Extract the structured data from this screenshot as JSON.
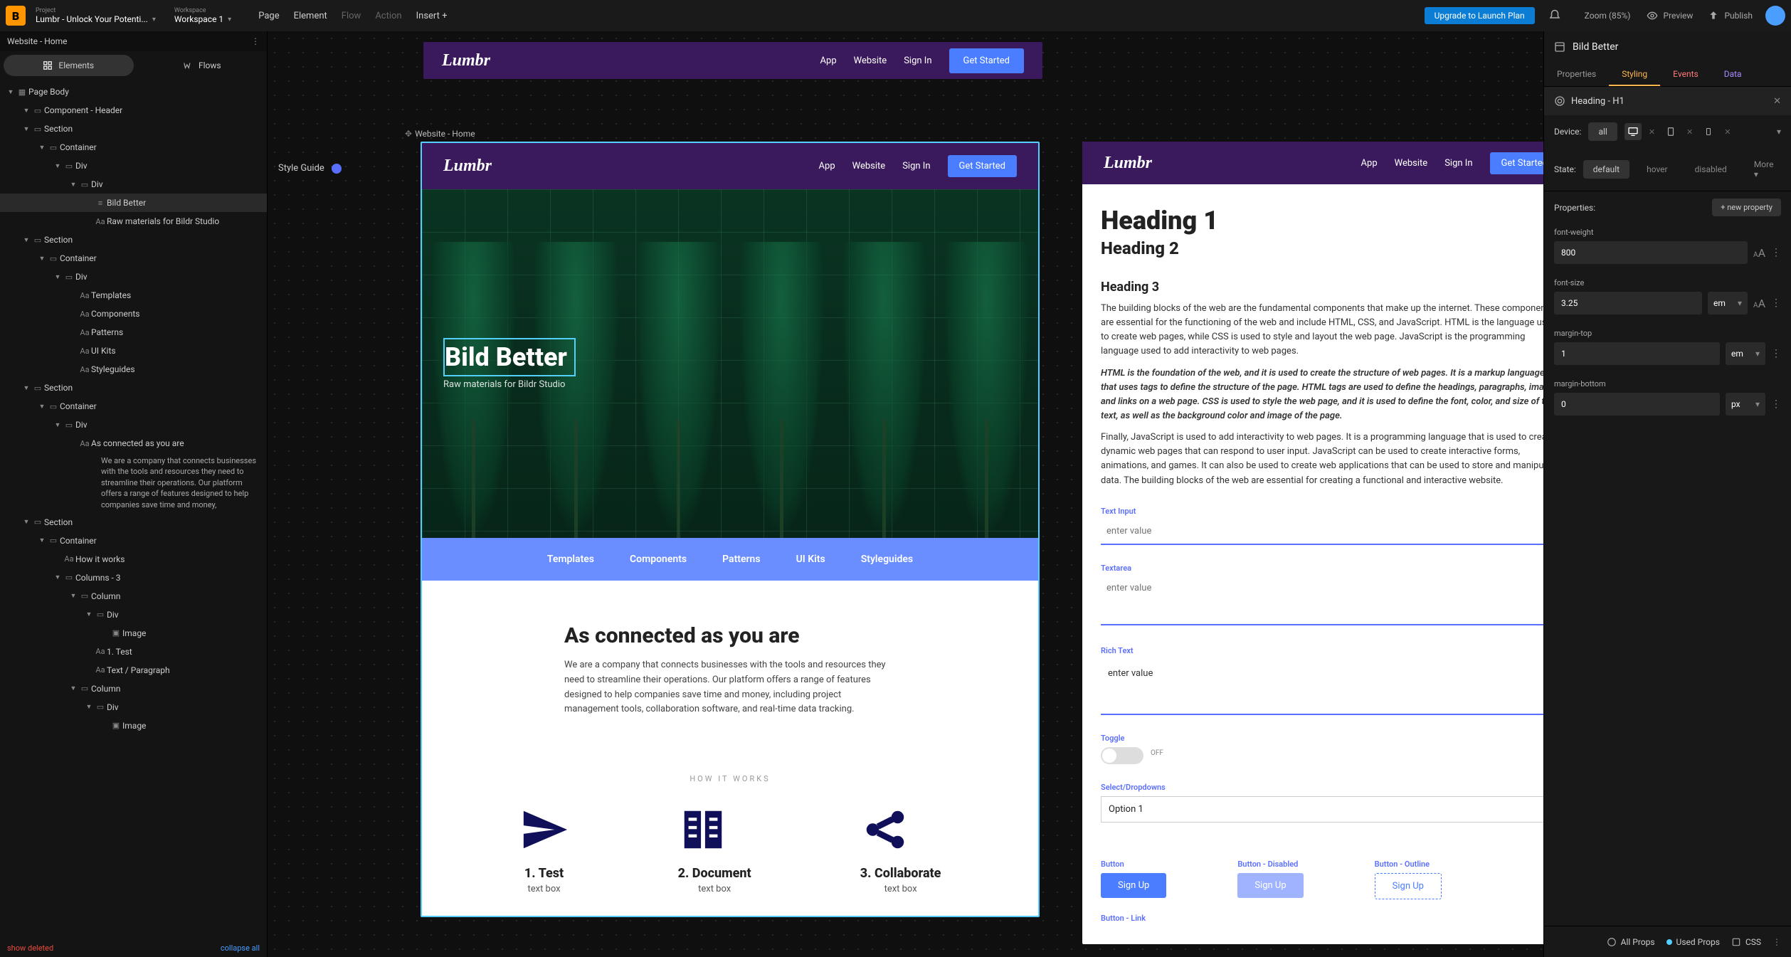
{
  "top": {
    "project_label": "Project",
    "project_name": "Lumbr - Unlock Your Potenti...",
    "workspace_label": "Workspace",
    "workspace_name": "Workspace 1",
    "menu": [
      "Page",
      "Element",
      "Flow",
      "Action",
      "Insert +"
    ],
    "upgrade": "Upgrade to Launch Plan",
    "zoom": "Zoom (85%)",
    "preview": "Preview",
    "publish": "Publish"
  },
  "breadcrumb": "Website - Home",
  "tabs": {
    "elements": "Elements",
    "flows": "Flows"
  },
  "tree": [
    {
      "d": 0,
      "t": "tog",
      "ic": "page",
      "lbl": "Page Body"
    },
    {
      "d": 1,
      "t": "tog",
      "ic": "box",
      "lbl": "Component - Header"
    },
    {
      "d": 1,
      "t": "tog",
      "ic": "box",
      "lbl": "Section"
    },
    {
      "d": 2,
      "t": "tog",
      "ic": "box",
      "lbl": "Container"
    },
    {
      "d": 3,
      "t": "tog",
      "ic": "box",
      "lbl": "Div"
    },
    {
      "d": 4,
      "t": "tog",
      "ic": "box",
      "lbl": "Div"
    },
    {
      "d": 5,
      "t": "none",
      "ic": "text",
      "lbl": "Bild Better",
      "sel": true
    },
    {
      "d": 5,
      "t": "none",
      "ic": "aa",
      "lbl": "Raw materials for Bildr Studio"
    },
    {
      "d": 1,
      "t": "tog",
      "ic": "box",
      "lbl": "Section"
    },
    {
      "d": 2,
      "t": "tog",
      "ic": "box",
      "lbl": "Container"
    },
    {
      "d": 3,
      "t": "tog",
      "ic": "box",
      "lbl": "Div"
    },
    {
      "d": 4,
      "t": "none",
      "ic": "aa",
      "lbl": "Templates"
    },
    {
      "d": 4,
      "t": "none",
      "ic": "aa",
      "lbl": "Components"
    },
    {
      "d": 4,
      "t": "none",
      "ic": "aa",
      "lbl": "Patterns"
    },
    {
      "d": 4,
      "t": "none",
      "ic": "aa",
      "lbl": "UI Kits"
    },
    {
      "d": 4,
      "t": "none",
      "ic": "aa",
      "lbl": "Styleguides"
    },
    {
      "d": 1,
      "t": "tog",
      "ic": "box",
      "lbl": "Section"
    },
    {
      "d": 2,
      "t": "tog",
      "ic": "box",
      "lbl": "Container"
    },
    {
      "d": 3,
      "t": "tog",
      "ic": "box",
      "lbl": "Div"
    },
    {
      "d": 4,
      "t": "none",
      "ic": "aa",
      "lbl": "As connected as you are"
    },
    {
      "d": 4,
      "t": "para",
      "ic": "aa",
      "lbl": "We are a company that connects businesses with the tools and resources they need to streamline their operations. Our platform offers a range of features designed to help companies save time and money,"
    },
    {
      "d": 1,
      "t": "tog",
      "ic": "box",
      "lbl": "Section"
    },
    {
      "d": 2,
      "t": "tog",
      "ic": "box",
      "lbl": "Container"
    },
    {
      "d": 3,
      "t": "none",
      "ic": "aa",
      "lbl": "How it works"
    },
    {
      "d": 3,
      "t": "tog",
      "ic": "box",
      "lbl": "Columns - 3"
    },
    {
      "d": 4,
      "t": "tog",
      "ic": "box",
      "lbl": "Column"
    },
    {
      "d": 5,
      "t": "tog",
      "ic": "box",
      "lbl": "Div"
    },
    {
      "d": 6,
      "t": "none",
      "ic": "img",
      "lbl": "Image"
    },
    {
      "d": 5,
      "t": "none",
      "ic": "aa",
      "lbl": "1. Test"
    },
    {
      "d": 5,
      "t": "none",
      "ic": "aa",
      "lbl": "Text / Paragraph"
    },
    {
      "d": 4,
      "t": "tog",
      "ic": "box",
      "lbl": "Column"
    },
    {
      "d": 5,
      "t": "tog",
      "ic": "box",
      "lbl": "Div"
    },
    {
      "d": 6,
      "t": "none",
      "ic": "img",
      "lbl": "Image"
    }
  ],
  "tree_footer": {
    "left": "show deleted",
    "right": "collapse all"
  },
  "canvas": {
    "frame_label": "Website - Home",
    "style_guide_label": "Style Guide",
    "brand": "Lumbr",
    "nav": [
      "App",
      "Website",
      "Sign In"
    ],
    "get_started": "Get Started",
    "hero_title": "Bild Better",
    "hero_sub": "Raw materials for Bildr Studio",
    "strip": [
      "Templates",
      "Components",
      "Patterns",
      "UI Kits",
      "Styleguides"
    ],
    "connected_h": "As connected as you are",
    "connected_p": "We are a company that connects businesses with the tools and resources they need to streamline their operations. Our platform offers a range of features designed to help companies save time and money, including project management tools, collaboration software, and real-time data tracking.",
    "hiw": "HOW IT WORKS",
    "cols": [
      {
        "h": "1. Test",
        "t": "text box"
      },
      {
        "h": "2. Document",
        "t": "text box"
      },
      {
        "h": "3. Collaborate",
        "t": "text box"
      }
    ]
  },
  "sf": {
    "h1": "Heading 1",
    "h2": "Heading 2",
    "h3": "Heading 3",
    "p1": "The building blocks of the web are the fundamental components that make up the internet. These components are essential for the functioning of the web and include HTML, CSS, and JavaScript. HTML is the language used to create web pages, while CSS is used to style and layout the web page. JavaScript is the programming language used to add interactivity to web pages.",
    "p2": "HTML is the foundation of the web, and it is used to create the structure of web pages. It is a markup language that uses tags to define the structure of the page. HTML tags are used to define the headings, paragraphs, images, and links on a web page. CSS is used to style the web page, and it is used to define the font, color, and size of the text, as well as the background color and image of the page.",
    "p3": "Finally, JavaScript is used to add interactivity to web pages. It is a programming language that is used to create dynamic web pages that can respond to user input. JavaScript can be used to create interactive forms, animations, and games. It can also be used to create web applications that can be used to store and manipulate data. The building blocks of the web are essential for creating a functional and interactive website.",
    "labels": {
      "ti": "Text Input",
      "ta": "Textarea",
      "rt": "Rich Text",
      "tg": "Toggle",
      "sd": "Select/Dropdowns",
      "btn": "Button",
      "btnd": "Button - Disabled",
      "btno": "Button - Outline",
      "btnl": "Button - Link"
    },
    "placeholder": "enter value",
    "toggle": "OFF",
    "option": "Option 1",
    "signup": "Sign Up"
  },
  "rp": {
    "title": "Bild Better",
    "tabs": [
      "Properties",
      "Styling",
      "Events",
      "Data"
    ],
    "selected": "Heading - H1",
    "device": {
      "label": "Device:",
      "all": "all"
    },
    "state": {
      "label": "State:",
      "items": [
        "default",
        "hover",
        "disabled",
        "More"
      ]
    },
    "props_label": "Properties:",
    "new_prop": "+ new property",
    "props": [
      {
        "name": "font-weight",
        "value": "800",
        "unit": "",
        "aa": true
      },
      {
        "name": "font-size",
        "value": "3.25",
        "unit": "em",
        "aa": true
      },
      {
        "name": "margin-top",
        "value": "1",
        "unit": "em",
        "aa": false
      },
      {
        "name": "margin-bottom",
        "value": "0",
        "unit": "px",
        "aa": false
      }
    ],
    "foot": {
      "all": "All Props",
      "used": "Used Props",
      "css": "CSS"
    }
  }
}
